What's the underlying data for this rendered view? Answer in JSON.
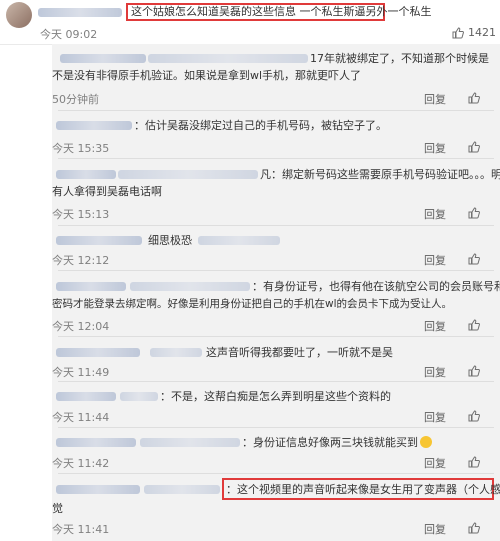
{
  "top_post": {
    "text": "这个姑娘怎么知道吴磊的这些信息 一个私生斯逼另外一个私生",
    "time": "今天 09:02",
    "like_count": "1421"
  },
  "comments": [
    {
      "line1": "17年就被绑定了，不知道那个时候是",
      "line2": "不是没有非得原手机验证。如果说是拿到wl手机，那就更吓人了",
      "time": "50分钟前",
      "reply": "回复"
    },
    {
      "line1": "：估计吴磊没绑定过自己的手机号码，被钻空子了。",
      "time": "今天 15:35",
      "reply": "回复"
    },
    {
      "line1": "凡：绑定新号码这些需要原手机号码验证吧。。。明显是",
      "line2": "有人拿得到吴磊电话啊",
      "time": "今天 15:13",
      "reply": "回复"
    },
    {
      "line1": "细思极恐",
      "time": "今天 12:12",
      "reply": "回复"
    },
    {
      "line1": "：有身份证号，也得有他在该航空公司的会员账号和",
      "line2": "密码才能登录去绑定啊。好像是利用身份证把自己的手机在wl的会员卡下成为受让人。",
      "time": "今天 12:04",
      "reply": "回复"
    },
    {
      "line1": "这声音听得我都要吐了，一听就不是吴",
      "time": "今天 11:49",
      "reply": "回复"
    },
    {
      "line1": "：不是，这帮白痴是怎么弄到明星这些个资料的",
      "time": "今天 11:44",
      "reply": "回复"
    },
    {
      "line1": "：身份证信息好像两三块钱就能买到",
      "time": "今天 11:42",
      "reply": "回复"
    },
    {
      "line1": "：这个视频里的声音听起来像是女生用了变声器（个人感",
      "line2": "觉",
      "time": "今天 11:41",
      "reply": "回复"
    }
  ],
  "colors": {
    "highlight": "#e03a3a",
    "panel_bg": "#f2f2f2"
  },
  "icons": {
    "like": "thumbs-up-icon",
    "emoji": "crying-laugh-emoji"
  }
}
